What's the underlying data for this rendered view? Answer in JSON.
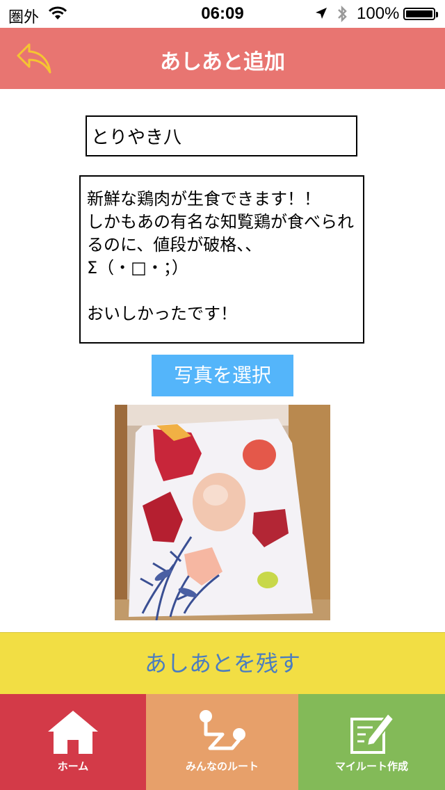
{
  "status_bar": {
    "carrier": "圏外",
    "time": "06:09",
    "battery": "100%",
    "icons": [
      "wifi-icon",
      "location-arrow-icon",
      "bluetooth-icon",
      "battery-icon"
    ]
  },
  "nav": {
    "title": "あしあと追加",
    "back_icon": "back-arrow-icon"
  },
  "form": {
    "name_value": "とりやき八",
    "comment_value": "新鮮な鶏肉が生食できます！！\nしかもあの有名な知覧鶏が食べられるのに、値段が破格、、\nΣ（・□・；）\n\nおいしかったです！",
    "photo_button_label": "写真を選択",
    "submit_label": "あしあとを残す"
  },
  "tabs": [
    {
      "label": "ホーム",
      "icon": "home-icon",
      "color": "#d33a48"
    },
    {
      "label": "みんなのルート",
      "icon": "route-icon",
      "color": "#e7a06a"
    },
    {
      "label": "マイルート作成",
      "icon": "pencil-note-icon",
      "color": "#83ba58"
    }
  ],
  "colors": {
    "nav": "#e87571",
    "photo_button": "#54b5fa",
    "submit": "#f2de44",
    "submit_text": "#4a7cc0",
    "back_arrow": "#f5c531"
  }
}
